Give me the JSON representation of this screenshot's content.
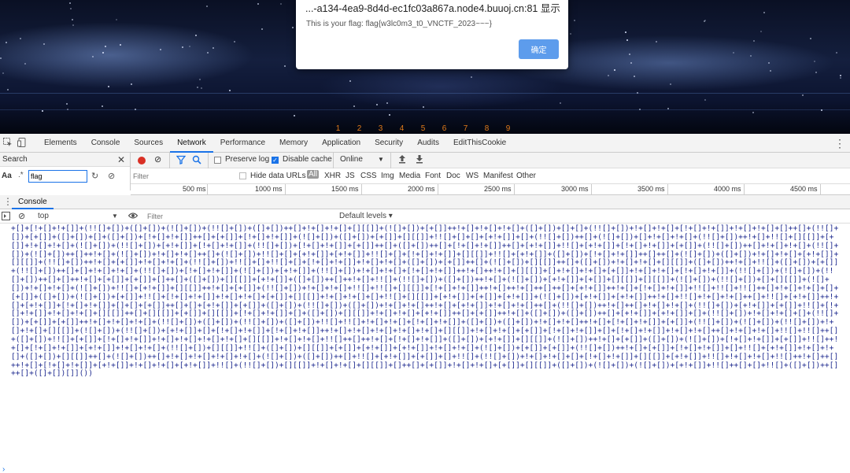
{
  "page": {
    "tabs": [
      "1",
      "2",
      "3",
      "4",
      "5",
      "6",
      "7",
      "8",
      "9"
    ]
  },
  "alert": {
    "title": "...-a134-4ea9-8d4d-ec1fc03a867a.node4.buuoj.cn:81 显示",
    "message": "This is your flag: flag{w3lc0m3_t0_VNCTF_2023~~~}",
    "ok_label": "确定",
    "ok_color": "#5d9cec"
  },
  "devtools": {
    "tabs": [
      "Elements",
      "Console",
      "Sources",
      "Network",
      "Performance",
      "Memory",
      "Application",
      "Security",
      "Audits",
      "EditThisCookie"
    ],
    "active_tab": "Network",
    "accent_color": "#1a73e8"
  },
  "search_panel": {
    "title": "Search",
    "case_label": "Aa",
    "regex_label": ".*",
    "query": "flag"
  },
  "network": {
    "preserve_log": "Preserve log",
    "disable_cache": "Disable cache",
    "throttling": "Online",
    "filter_placeholder": "Filter",
    "hide_data_urls": "Hide data URLs",
    "type_filters": [
      "All",
      "XHR",
      "JS",
      "CSS",
      "Img",
      "Media",
      "Font",
      "Doc",
      "WS",
      "Manifest",
      "Other"
    ],
    "timeline_ticks": [
      "500 ms",
      "1000 ms",
      "1500 ms",
      "2000 ms",
      "2500 ms",
      "3000 ms",
      "3500 ms",
      "4000 ms",
      "4500 ms"
    ]
  },
  "console": {
    "drawer_tab": "Console",
    "context": "top",
    "filter_placeholder": "Filter",
    "levels": "Default levels ▾",
    "code_color": "#1e2a8f",
    "prompt": "›"
  }
}
